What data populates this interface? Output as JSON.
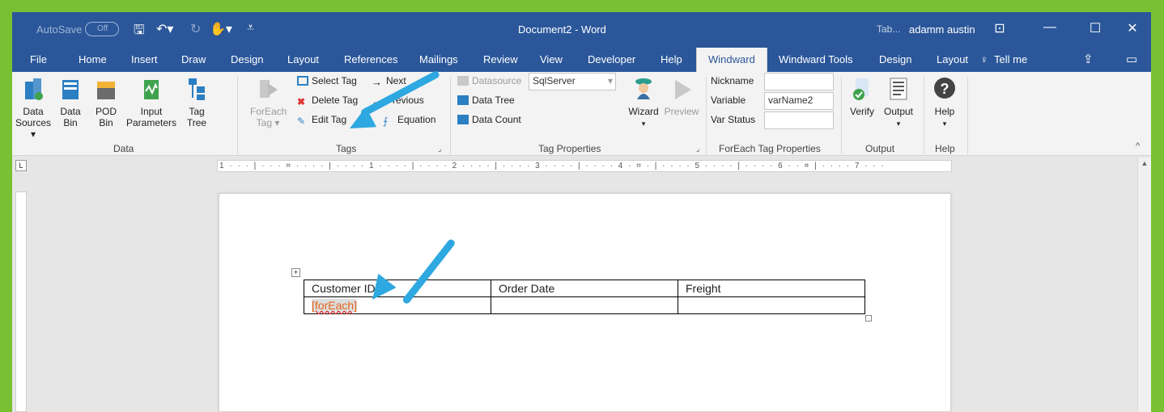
{
  "titlebar": {
    "autosave": "AutoSave",
    "autosave_state": "Off",
    "doc_title": "Document2  -  Word",
    "tab_hint": "Tab...",
    "user": "adamm austin"
  },
  "tabs": [
    "File",
    "Home",
    "Insert",
    "Draw",
    "Design",
    "Layout",
    "References",
    "Mailings",
    "Review",
    "View",
    "Developer",
    "Help",
    "Windward",
    "Windward Tools",
    "Design",
    "Layout",
    "Tell me"
  ],
  "ribbon": {
    "data": {
      "label": "Data",
      "buttons": [
        "Data Sources",
        "Data Bin",
        "POD Bin",
        "Input Parameters",
        "Tag Tree"
      ],
      "sub": [
        "Sources ▾",
        "Bin",
        "Bin",
        "Parameters",
        "Tree"
      ],
      "top": [
        "Data",
        "Data",
        "POD",
        "Input",
        "Tag"
      ]
    },
    "tags": {
      "label": "Tags",
      "foreach": "ForEach",
      "foreach2": "Tag ▾",
      "select_tag": "Select Tag",
      "delete_tag": "Delete Tag",
      "edit_tag": "Edit Tag",
      "next": "Next",
      "previous": "Previous",
      "equation": "Equation"
    },
    "tag_properties": {
      "label": "Tag Properties",
      "datasource": "Datasource",
      "datasource_value": "SqlServer",
      "data_tree": "Data Tree",
      "data_count": "Data Count",
      "wizard": "Wizard",
      "preview": "Preview"
    },
    "foreach_props": {
      "label": "ForEach Tag Properties",
      "nickname": "Nickname",
      "variable": "Variable",
      "variable_value": "varName2",
      "var_status": "Var Status"
    },
    "output": {
      "label": "Output",
      "verify": "Verify",
      "output": "Output"
    },
    "help": {
      "label": "Help",
      "help": "Help"
    }
  },
  "ruler": "1 · · · | · · · ⌗ · · · · | · · · · 1 · · · · | · · · · 2 · · · · | · · · · 3 · · · · | · · · · 4 · ⌗ · | · · · · 5 · · · · | · · · · 6 · · ⌗ | · · · · 7 · · ·",
  "document": {
    "headers": [
      "Customer ID",
      "Order Date",
      "Freight"
    ],
    "row": [
      "[forEach]",
      "",
      ""
    ]
  },
  "colors": {
    "accent": "#2b579a",
    "frame": "#79c032",
    "arrow": "#2ea8e0",
    "tag": "#e8641b"
  }
}
